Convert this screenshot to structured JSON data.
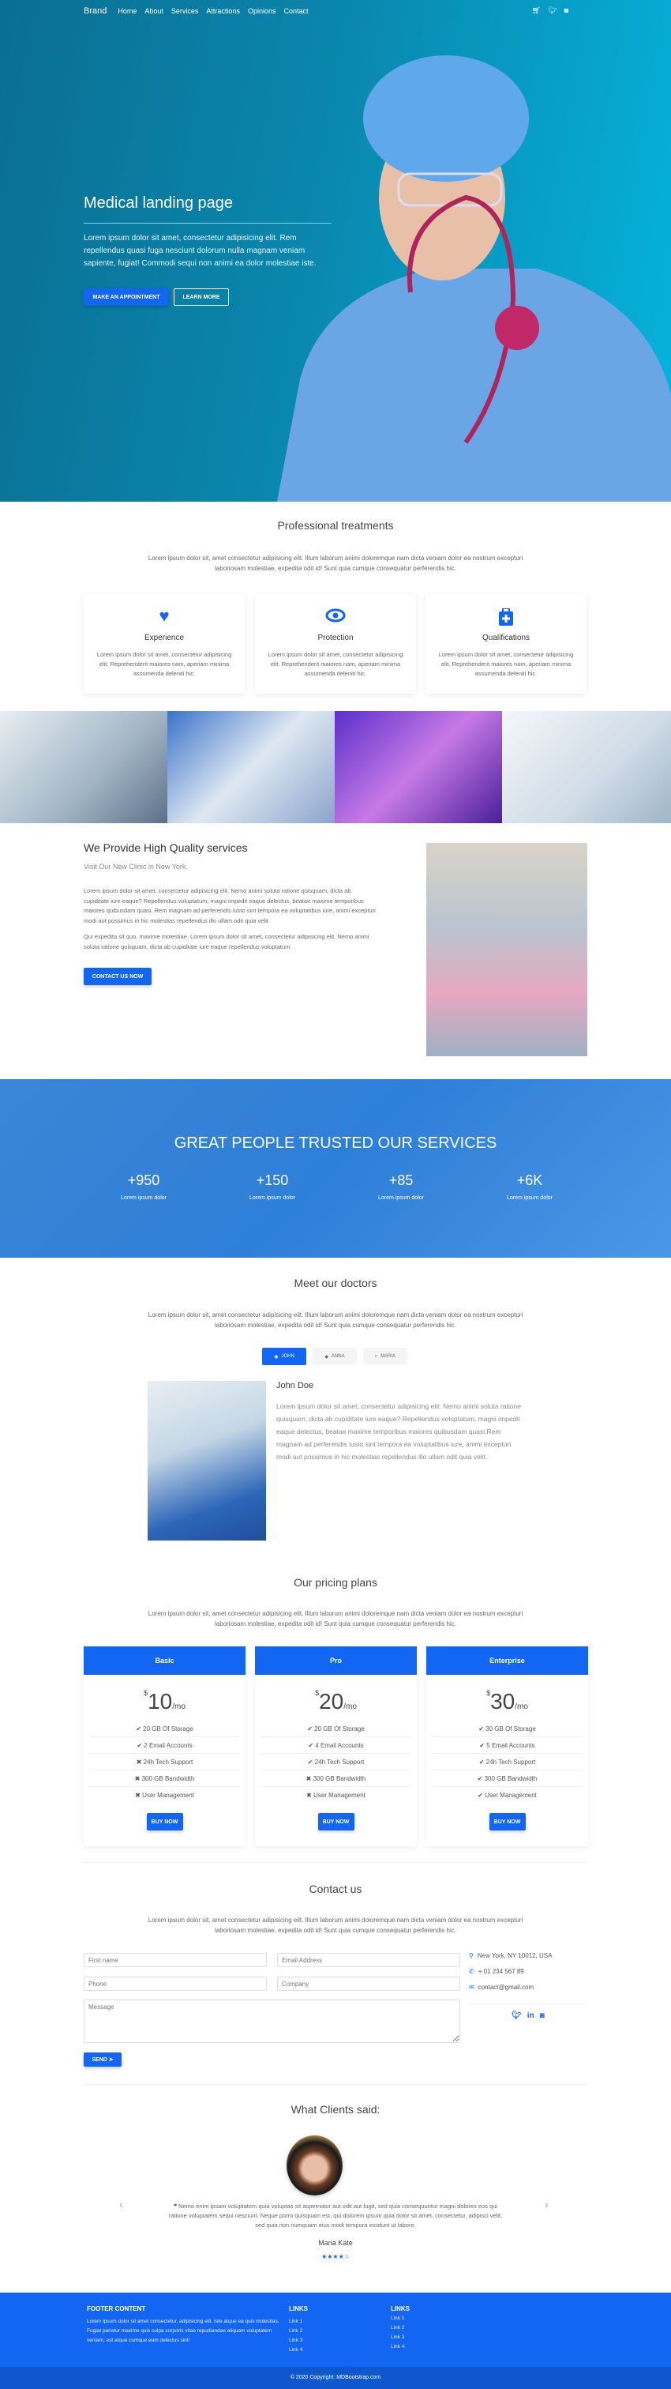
{
  "nav": {
    "brand": "Brand",
    "items": [
      "Home",
      "About",
      "Services",
      "Attractions",
      "Opinions",
      "Contact"
    ],
    "icons": [
      "cart-icon",
      "twitter-icon",
      "instagram-icon"
    ]
  },
  "hero": {
    "title": "Medical landing page",
    "text": "Lorem ipsum dolor sit amet, consectetur adipisicing elit. Rem repellendus quasi fuga nesciunt dolorum nulla magnam veniam sapiente, fugiat! Commodi sequi non animi ea dolor molestiae iste.",
    "btn_primary": "MAKE AN APPOINTMENT",
    "btn_secondary": "LEARN MORE"
  },
  "treatments": {
    "title": "Professional treatments",
    "lead": "Lorem ipsum dolor sit, amet consectetur adipisicing elit. Illum laborum animi doloremque nam dicta veniam dolor ea nostrum excepturi laboriosam molestiae, expedita odit id! Sunt quia cumque consequatur perferendis hic.",
    "cards": [
      {
        "icon": "heart-icon",
        "title": "Experience",
        "text": "Lorem ipsum dolor sit amet, consectetur adipisicing elit. Reprehenderit maiores nam, aperiam minima assumenda deleniti hic."
      },
      {
        "icon": "eye-icon",
        "title": "Protection",
        "text": "Lorem ipsum dolor sit amet, consectetur adipisicing elit. Reprehenderit maiores nam, aperiam minima assumenda deleniti hic."
      },
      {
        "icon": "medkit-icon",
        "title": "Qualifications",
        "text": "Lorem ipsum dolor sit amet, consectetur adipisicing elit. Reprehenderit maiores nam, aperiam minima assumenda deleniti hic."
      }
    ]
  },
  "services": {
    "title": "We Provide High Quality services",
    "subtitle": "Visit Our New Clinic in New York.",
    "p1": "Lorem ipsum dolor sit amet, consectetur adipisicing elit. Nemo animi soluta ratione quisquam, dicta ab cupiditate iure eaque? Repellendus voluptatum, magni impedit eaque delectus, beatae maxime temporibus maiores quibusdam quasi. Rem magnam ad perferendis iusto sint tempora ea voluptatibus iure, animi excepturi modi aut possimus in hic molestias repellendus illo ullam odit quia velit.",
    "p2": "Qui expedita sit quo, maxime molestiae. Lorem ipsum dolor sit amet, consectetur adipisicing elit. Nemo animi soluta ratione quisquam, dicta ab cupiditate iure eaque repellendus voluptatum.",
    "button": "CONTACT US NOW"
  },
  "trust": {
    "title": "GREAT PEOPLE TRUSTED OUR SERVICES",
    "stats": [
      {
        "value": "+950",
        "label": "Lorem ipsum dolor"
      },
      {
        "value": "+150",
        "label": "Lorem ipsum dolor"
      },
      {
        "value": "+85",
        "label": "Lorem ipsum dolor"
      },
      {
        "value": "+6K",
        "label": "Lorem ipsum dolor"
      }
    ]
  },
  "doctors": {
    "title": "Meet our doctors",
    "lead": "Lorem ipsum dolor sit, amet consectetur adipisicing elit. Illum laborum animi doloremque nam dicta veniam dolor ea nostrum excepturi laboriosam molestiae, expedita odit id! Sunt quia cumque consequatur perferendis hic.",
    "tabs": [
      "JOHN",
      "ANNA",
      "MARIA"
    ],
    "name": "John Doe",
    "bio": "Lorem ipsum dolor sit amet, consectetur adipisicing elit. Nemo animi soluta ratione quisquam, dicta ab cupiditate iure eaque? Repellendus voluptatum, magni impedit eaque delectus, beatae maxime temporibus maiores quibusdam quasi.Rem magnam ad perferendis iusto sint tempora ea voluptatibus iure, animi excepturi modi aut possimus in hic molestias repellendus illo ullam odit quia velit."
  },
  "pricing": {
    "title": "Our pricing plans",
    "lead": "Lorem ipsum dolor sit, amet consectetur adipisicing elit. Illum laborum animi doloremque nam dicta veniam dolor ea nostrum excepturi laboriosam molestiae, expedita odit id! Sunt quia cumque consequatur perferendis hic.",
    "plans": [
      {
        "name": "Basic",
        "currency": "$",
        "price": "10",
        "period": "/mo",
        "button": "BUY NOW",
        "features": [
          [
            "✔",
            "20 GB Of Storage"
          ],
          [
            "✔",
            "2 Email Accounts"
          ],
          [
            "✖",
            "24h Tech Support"
          ],
          [
            "✖",
            "300 GB Bandwidth"
          ],
          [
            "✖",
            "User Management"
          ]
        ]
      },
      {
        "name": "Pro",
        "currency": "$",
        "price": "20",
        "period": "/mo",
        "button": "BUY NOW",
        "features": [
          [
            "✔",
            "20 GB Of Storage"
          ],
          [
            "✔",
            "4 Email Accounts"
          ],
          [
            "✔",
            "24h Tech Support"
          ],
          [
            "✖",
            "300 GB Bandwidth"
          ],
          [
            "✖",
            "User Management"
          ]
        ]
      },
      {
        "name": "Enterprise",
        "currency": "$",
        "price": "30",
        "period": "/mo",
        "button": "BUY NOW",
        "features": [
          [
            "✔",
            "30 GB Of Storage"
          ],
          [
            "✔",
            "5 Email Accounts"
          ],
          [
            "✔",
            "24h Tech Support"
          ],
          [
            "✔",
            "300 GB Bandwidth"
          ],
          [
            "✔",
            "User Management"
          ]
        ]
      }
    ]
  },
  "contact": {
    "title": "Contact us",
    "lead": "Lorem ipsum dolor sit, amet consectetur adipisicing elit. Illum laborum animi doloremque nam dicta veniam dolor ea nostrum excepturi laboriosam molestiae, expedita odit id! Sunt quia cumque consequatur perferendis hic.",
    "placeholders": {
      "first": "First name",
      "email": "Email Address",
      "phone": "Phone",
      "company": "Company",
      "message": "Message"
    },
    "send": "SEND",
    "address": "New York, NY 10012, USA",
    "phone": "+ 01 234 567 89",
    "email": "contact@gmail.com"
  },
  "clients": {
    "title": "What Clients said:",
    "quote": "Nemo enim ipsam voluptatem quia voluptas sit aspernatur aut odit aut fugit, sed quia consequuntur magni dolores eos qui ratione voluptatem sequi nesciunt. Neque porro quisquam est, qui dolorem ipsum quia dolor sit amet, consectetur, adipisci velit, sed quia non numquam eius modi tempora incidunt ut labore.",
    "name": "Maria Kate",
    "rating": 4,
    "rating_max": 5
  },
  "footer": {
    "title": "FOOTER CONTENT",
    "text": "Lorem ipsum dolor sit amet consectetur, adipisicing elit. Iste atque ea quis molestias. Fugiat pariatur maxime quis culpa corporis vitae repudiandae aliquam voluptatem veniam, est atque cumque eum delectus sint!",
    "links1_title": "LINKS",
    "links1": [
      "Link 1",
      "Link 2",
      "Link 3",
      "Link 4"
    ],
    "links2_title": "LINKS",
    "links2": [
      "Link 1",
      "Link 2",
      "Link 3",
      "Link 4"
    ],
    "copyright": "© 2020 Copyright: MDBootstrap.com"
  },
  "colors": {
    "primary": "#1266f1",
    "hero": "#0a86ad"
  }
}
